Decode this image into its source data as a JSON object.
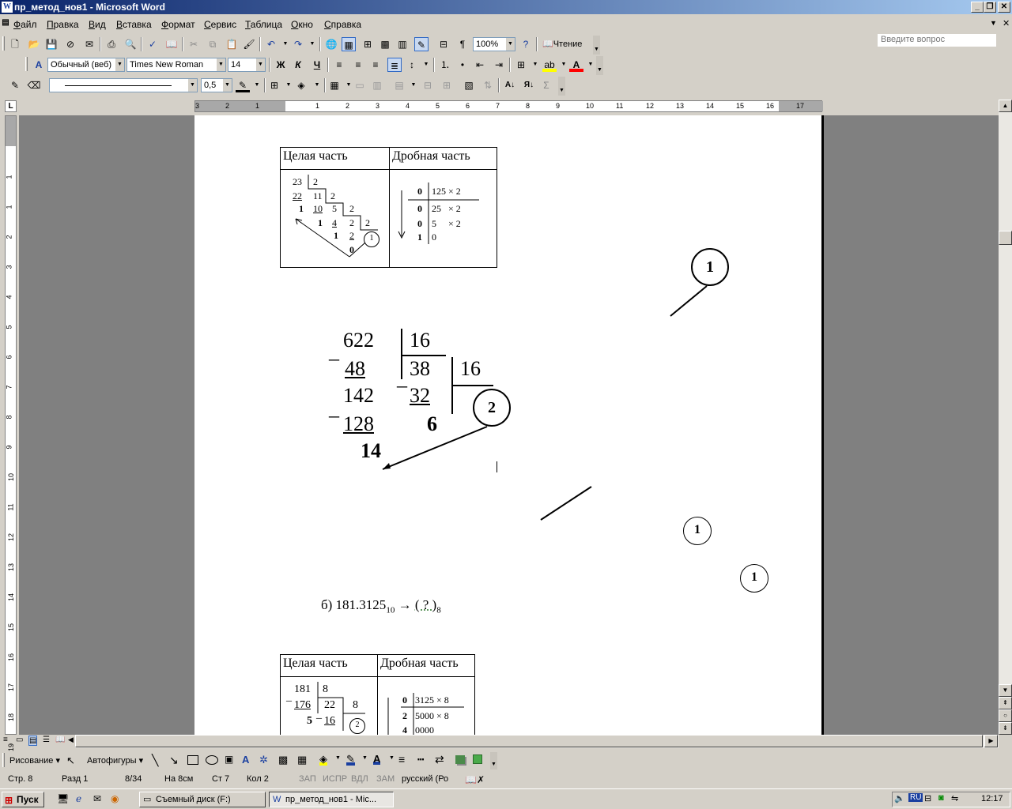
{
  "window": {
    "title": "пр_метод_нов1 - Microsoft Word"
  },
  "menu": {
    "items": [
      "Файл",
      "Правка",
      "Вид",
      "Вставка",
      "Формат",
      "Сервис",
      "Таблица",
      "Окно",
      "Справка"
    ],
    "ask_placeholder": "Введите вопрос"
  },
  "toolbar_standard": {
    "zoom": "100%",
    "reading_label": "Чтение"
  },
  "toolbar_format": {
    "style": "Обычный (веб)",
    "font": "Times New Roman",
    "size": "14"
  },
  "toolbar_tables": {
    "line_weight": "0,5"
  },
  "ruler": {
    "numbers": [
      "3",
      "2",
      "1",
      "1",
      "2",
      "3",
      "4",
      "5",
      "6",
      "7",
      "8",
      "9",
      "10",
      "11",
      "12",
      "13",
      "14",
      "15",
      "16",
      "17"
    ]
  },
  "vruler": {
    "numbers": [
      "1",
      "1",
      "2",
      "3",
      "4",
      "5",
      "6",
      "7",
      "8",
      "9",
      "10",
      "11",
      "12",
      "13",
      "14",
      "15",
      "16",
      "17",
      "18",
      "19"
    ]
  },
  "document": {
    "table1": {
      "header_int": "Целая часть",
      "header_frac": "Дробная часть",
      "int_rows": [
        "23",
        "2",
        "22",
        "11",
        "2",
        "1",
        "10",
        "5",
        "2",
        "1",
        "4",
        "2",
        "2",
        "1",
        "2",
        "1",
        "0"
      ],
      "frac_rows": [
        [
          "0",
          "125 × 2"
        ],
        [
          "0",
          "25   × 2"
        ],
        [
          "0",
          "5     × 2"
        ],
        [
          "1",
          "0"
        ]
      ],
      "circle": "1"
    },
    "division": {
      "d1": "622",
      "d2": "16",
      "s1": "48",
      "r1": "38",
      "d3": "16",
      "s2": "142",
      "s3": "32",
      "s4": "128",
      "q": "6",
      "rem": "14"
    },
    "callouts": [
      "1",
      "2",
      "1",
      "1"
    ],
    "task_b": {
      "prefix": "б) 181.3125",
      "base_from": "10",
      "arrow": "→",
      "target": "( ? )",
      "base_to": "8"
    },
    "table2": {
      "header_int": "Целая часть",
      "header_frac": "Дробная часть",
      "int_rows": [
        "181",
        "8",
        "176",
        "22",
        "8",
        "5",
        "16"
      ],
      "frac_rows": [
        [
          "0",
          "3125 × 8"
        ],
        [
          "2",
          "5000 × 8"
        ],
        [
          "4",
          "0000"
        ]
      ],
      "circle": "2"
    }
  },
  "drawbar": {
    "draw": "Рисование",
    "autoshapes": "Автофигуры"
  },
  "status": {
    "page": "Стр. 8",
    "section": "Разд 1",
    "pages": "8/34",
    "at": "На 8см",
    "line": "Ст 7",
    "col": "Кол 2",
    "rec": "ЗАП",
    "trk": "ИСПР",
    "ext": "ВДЛ",
    "ovr": "ЗАМ",
    "lang": "русский (Ро"
  },
  "taskbar": {
    "start": "Пуск",
    "task1": "Съемный диск (F:)",
    "task2": "пр_метод_нов1 - Mic...",
    "lang": "RU",
    "clock": "12:17"
  }
}
